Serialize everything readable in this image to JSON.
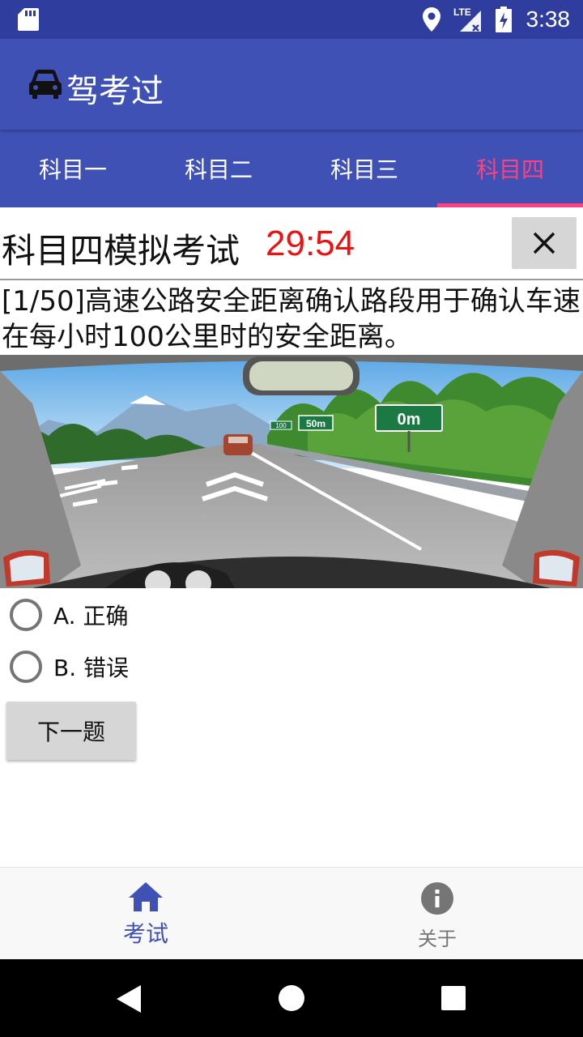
{
  "status_bar": {
    "time": "3:38",
    "network": "LTE",
    "icons": [
      "sd-card-icon",
      "location-icon",
      "signal-icon",
      "battery-charging-icon"
    ]
  },
  "app_bar": {
    "title": "驾考过",
    "icon": "car-icon"
  },
  "tabs": [
    {
      "label": "科目一",
      "active": false
    },
    {
      "label": "科目二",
      "active": false
    },
    {
      "label": "科目三",
      "active": false
    },
    {
      "label": "科目四",
      "active": true
    }
  ],
  "exam": {
    "title": "科目四模拟考试",
    "timer": "29:54",
    "close_icon": "close-icon"
  },
  "question": {
    "text": "[1/50]高速公路安全距离确认路段用于确认车速在每小时100公里时的安全距离。",
    "image_signs": {
      "speed": "100",
      "distance_small": "50m",
      "distance_big": "0m"
    }
  },
  "options": [
    {
      "label": "A. 正确",
      "selected": false
    },
    {
      "label": "B. 错误",
      "selected": false
    }
  ],
  "next_button": {
    "label": "下一题"
  },
  "bottom_nav": [
    {
      "label": "考试",
      "icon": "home-icon",
      "active": true
    },
    {
      "label": "关于",
      "icon": "info-icon",
      "active": false
    }
  ],
  "colors": {
    "primary": "#3f51b5",
    "primary_dark": "#2f3e9e",
    "accent": "#ff4081",
    "timer": "#ee1111"
  }
}
